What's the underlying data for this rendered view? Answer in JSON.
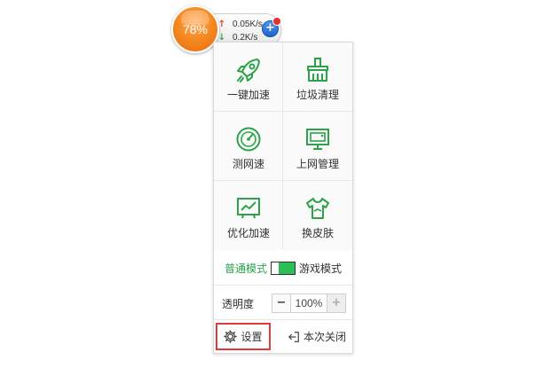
{
  "speed_ball": {
    "percent": "78%",
    "upload_speed": "0.05K/s",
    "download_speed": "0.2K/s",
    "icons": [
      "upload-arrow-icon",
      "download-arrow-icon",
      "plus-icon"
    ]
  },
  "tools": [
    {
      "label": "一键加速",
      "icon": "rocket-icon"
    },
    {
      "label": "垃圾清理",
      "icon": "broom-icon"
    },
    {
      "label": "测网速",
      "icon": "speedometer-icon"
    },
    {
      "label": "上网管理",
      "icon": "monitor-icon"
    },
    {
      "label": "优化加速",
      "icon": "chart-screen-icon"
    },
    {
      "label": "换皮肤",
      "icon": "tshirt-icon"
    }
  ],
  "mode": {
    "normal_label": "普通模式",
    "game_label": "游戏模式",
    "active": "normal"
  },
  "opacity": {
    "label": "透明度",
    "minus": "−",
    "value": "100%",
    "plus": "+"
  },
  "footer": {
    "settings_label": "设置",
    "close_label": "本次关闭"
  },
  "colors": {
    "accent_green": "#2aa34a",
    "icon_green": "#2aa34a",
    "orb_orange": "#f58a22",
    "highlight_red": "#e03a3a"
  }
}
